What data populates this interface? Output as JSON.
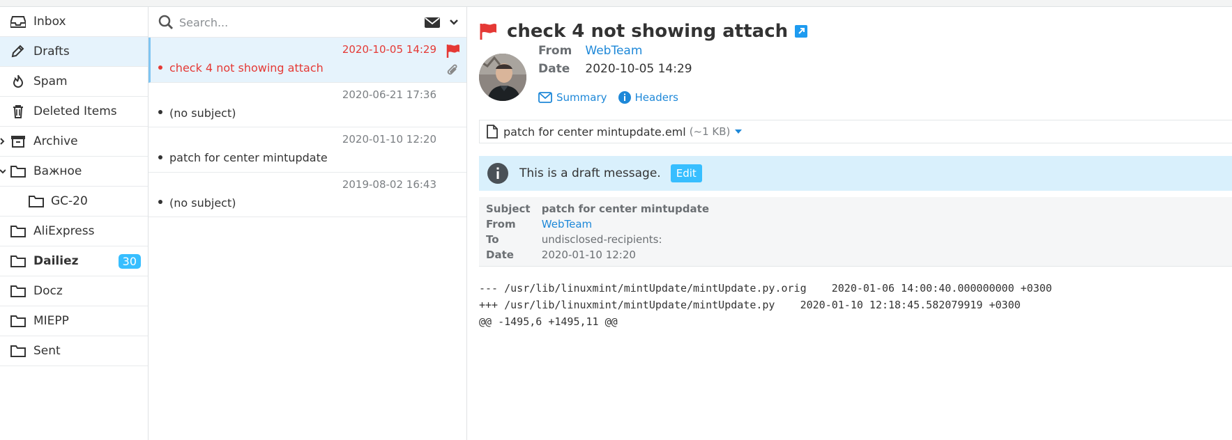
{
  "sidebar": {
    "folders": [
      {
        "label": "Inbox"
      },
      {
        "label": "Drafts"
      },
      {
        "label": "Spam"
      },
      {
        "label": "Deleted Items"
      },
      {
        "label": "Archive"
      },
      {
        "label": "Важное"
      },
      {
        "label": "GC-20"
      },
      {
        "label": "AliExpress"
      },
      {
        "label": "Dailiez",
        "unread": "30"
      },
      {
        "label": "Docz"
      },
      {
        "label": "MIEPP"
      },
      {
        "label": "Sent"
      }
    ]
  },
  "search": {
    "placeholder": "Search..."
  },
  "messages": [
    {
      "date": "2020-10-05 14:29",
      "subject": "check 4 not showing attach",
      "flagged": true,
      "attachment": true
    },
    {
      "date": "2020-06-21 17:36",
      "subject": "(no subject)"
    },
    {
      "date": "2020-01-10 12:20",
      "subject": "patch for center mintupdate"
    },
    {
      "date": "2019-08-02 16:43",
      "subject": "(no subject)"
    }
  ],
  "view": {
    "title": "check 4 not showing attach",
    "from_label": "From",
    "from_value": "WebTeam",
    "date_label": "Date",
    "date_value": "2020-10-05 14:29",
    "summary_label": "Summary",
    "headers_label": "Headers",
    "attachment": {
      "name": "patch for center mintupdate.eml",
      "size": "(~1 KB)"
    },
    "notice": {
      "text": "This is a draft message.",
      "edit_label": "Edit"
    },
    "embedded_headers": {
      "subject_label": "Subject",
      "subject_value": "patch for center mintupdate",
      "from_label": "From",
      "from_value": "WebTeam",
      "to_label": "To",
      "to_value": "undisclosed-recipients:",
      "date_label": "Date",
      "date_value": "2020-01-10 12:20"
    },
    "body_lines": [
      "--- /usr/lib/linuxmint/mintUpdate/mintUpdate.py.orig    2020-01-06 14:00:40.000000000 +0300",
      "+++ /usr/lib/linuxmint/mintUpdate/mintUpdate.py    2020-01-10 12:18:45.582079919 +0300",
      "@@ -1495,6 +1495,11 @@"
    ]
  },
  "colors": {
    "accent": "#37beff",
    "link": "#1e88d8",
    "flag": "#e53935",
    "selected_bg": "#e6f3fc",
    "notice_bg": "#d9f0fc"
  }
}
